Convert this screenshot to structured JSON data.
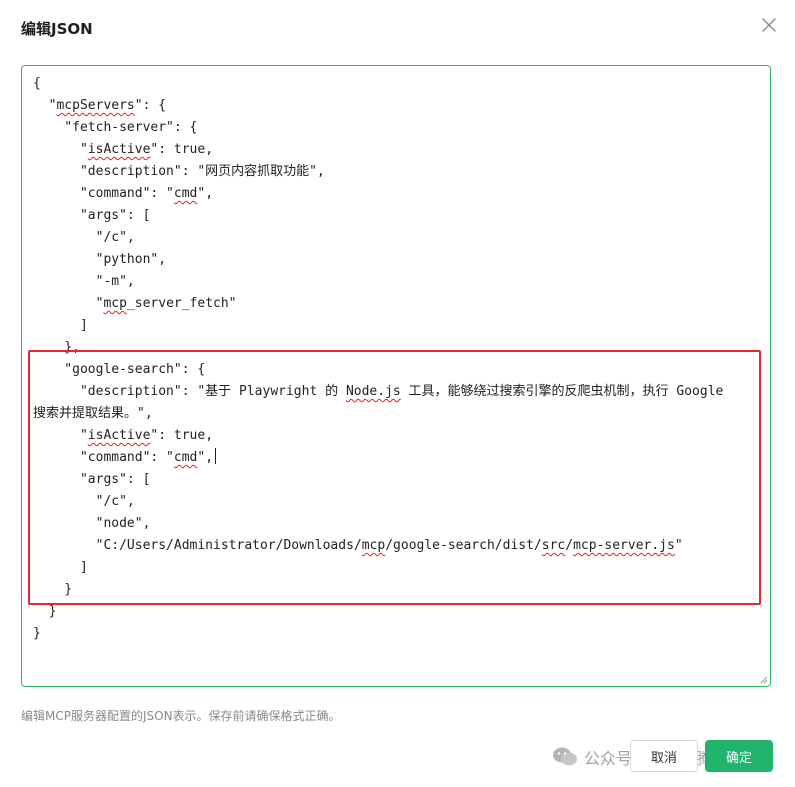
{
  "dialog": {
    "title": "编辑JSON",
    "hint": "编辑MCP服务器配置的JSON表示。保存前请确保格式正确。",
    "cancel_label": "取消",
    "confirm_label": "确定",
    "close_icon": "close-icon",
    "accent_color": "#20b46a",
    "highlight_color": "#e8262a"
  },
  "watermark": {
    "text": "公众号 · 各种折腾"
  },
  "editor": {
    "lines": [
      {
        "segments": [
          {
            "t": "{"
          }
        ]
      },
      {
        "segments": [
          {
            "t": "  \""
          },
          {
            "t": "mcpServers",
            "w": true
          },
          {
            "t": "\": {"
          }
        ]
      },
      {
        "segments": [
          {
            "t": "    \"fetch-server\": {"
          }
        ]
      },
      {
        "segments": [
          {
            "t": "      \""
          },
          {
            "t": "isActive",
            "w": true
          },
          {
            "t": "\": true,"
          }
        ]
      },
      {
        "segments": [
          {
            "t": "      \"description\": \"网页内容抓取功能\","
          }
        ]
      },
      {
        "segments": [
          {
            "t": "      \"command\": \""
          },
          {
            "t": "cmd",
            "w": true
          },
          {
            "t": "\","
          }
        ]
      },
      {
        "segments": [
          {
            "t": "      \"args\": ["
          }
        ]
      },
      {
        "segments": [
          {
            "t": "        \"/c\","
          }
        ]
      },
      {
        "segments": [
          {
            "t": "        \"python\","
          }
        ]
      },
      {
        "segments": [
          {
            "t": "        \"-m\","
          }
        ]
      },
      {
        "segments": [
          {
            "t": "        \""
          },
          {
            "t": "mcp",
            "w": true
          },
          {
            "t": "_server_fetch\""
          }
        ]
      },
      {
        "segments": [
          {
            "t": "      ]"
          }
        ]
      },
      {
        "segments": [
          {
            "t": "    },"
          }
        ]
      },
      {
        "segments": [
          {
            "t": "    \"google-search\": {"
          }
        ]
      },
      {
        "segments": [
          {
            "t": "      \"description\": \"基于 Playwright 的 "
          },
          {
            "t": "Node.js",
            "w": true
          },
          {
            "t": " 工具，能够绕过搜索引擎的反爬虫机制，执行 Google"
          }
        ]
      },
      {
        "segments": [
          {
            "t": "搜索并提取结果。\","
          }
        ]
      },
      {
        "segments": [
          {
            "t": "      \""
          },
          {
            "t": "isActive",
            "w": true
          },
          {
            "t": "\": true,"
          }
        ]
      },
      {
        "segments": [
          {
            "t": "      \"command\": \""
          },
          {
            "t": "cmd",
            "w": true
          },
          {
            "t": "\","
          }
        ],
        "caret": true
      },
      {
        "segments": [
          {
            "t": "      \"args\": ["
          }
        ]
      },
      {
        "segments": [
          {
            "t": "        \"/c\","
          }
        ]
      },
      {
        "segments": [
          {
            "t": "        \"node\","
          }
        ]
      },
      {
        "segments": [
          {
            "t": "        \"C:/Users/Administrator/Downloads/"
          },
          {
            "t": "mcp",
            "w": true
          },
          {
            "t": "/google-search/dist/"
          },
          {
            "t": "src",
            "w": true
          },
          {
            "t": "/"
          },
          {
            "t": "mcp-server.js",
            "w": true
          },
          {
            "t": "\""
          }
        ]
      },
      {
        "segments": [
          {
            "t": "      ]"
          }
        ]
      },
      {
        "segments": [
          {
            "t": "    }"
          }
        ]
      },
      {
        "segments": [
          {
            "t": "  }"
          }
        ]
      },
      {
        "segments": [
          {
            "t": "}"
          }
        ]
      }
    ]
  }
}
